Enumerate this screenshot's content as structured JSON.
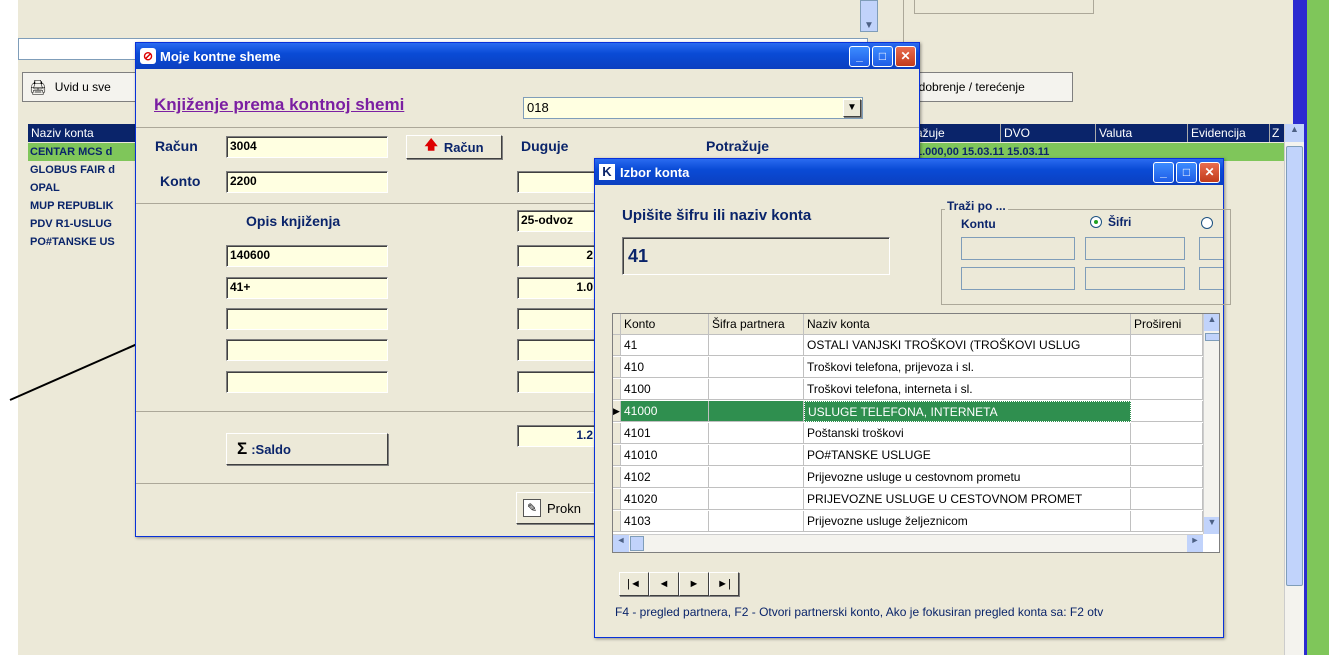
{
  "background_app": {
    "toolbar_view_label": "Uvid u sve",
    "toolbar_right_label": "odobrenje / terećenje",
    "grid_headers": [
      "Naziv konta",
      "ažuje",
      "DVO",
      "Valuta",
      "Evidencija",
      "Z"
    ],
    "grid_rows": [
      "CENTAR MCS d",
      "GLOBUS FAIR d",
      "OPAL",
      "MUP REPUBLIK",
      "PDV R1-USLUG",
      "PO#TANSKE US"
    ],
    "first_row_values": "1.000,00 15.03.11     15.03.11"
  },
  "main_window": {
    "title": "Moje kontne sheme",
    "heading": "Knjiženje prema kontnoj shemi",
    "scheme_value": "018",
    "racun_label": "Račun",
    "racun_value": "3004",
    "racun_button": "Račun",
    "duguje_label": "Duguje",
    "potrazuje_label": "Potražuje",
    "konto_label": "Konto",
    "konto_value": "2200",
    "opis_label": "Opis knjiženja",
    "opis_rows": [
      "140600",
      "41+",
      "",
      "",
      ""
    ],
    "type_value": "25-odvoz",
    "amount_rows": [
      "2",
      "1.0",
      "",
      "",
      ""
    ],
    "saldo_button": ":Saldo",
    "saldo_value": "1.2",
    "proknjizi_label": "Prokn"
  },
  "izbor_window": {
    "title": "Izbor konta",
    "prompt": "Upišite šifru ili naziv konta",
    "search_value": "41",
    "trazi_po_label": "Traži po ...",
    "kontu_label": "Kontu",
    "sifri_label": "Šifri",
    "columns": [
      "Konto",
      "Šifra partnera",
      "Naziv konta",
      "Prošireni"
    ],
    "rows": [
      {
        "konto": "41",
        "sifra": "",
        "naziv": "OSTALI VANJSKI TROŠKOVI (TROŠKOVI USLUG"
      },
      {
        "konto": "410",
        "sifra": "",
        "naziv": "Troškovi telefona, prijevoza i sl."
      },
      {
        "konto": "4100",
        "sifra": "",
        "naziv": "Troškovi telefona, interneta i sl."
      },
      {
        "konto": "41000",
        "sifra": "",
        "naziv": "USLUGE TELEFONA, INTERNETA"
      },
      {
        "konto": "4101",
        "sifra": "",
        "naziv": "Poštanski troškovi"
      },
      {
        "konto": "41010",
        "sifra": "",
        "naziv": "PO#TANSKE USLUGE"
      },
      {
        "konto": "4102",
        "sifra": "",
        "naziv": "Prijevozne usluge u cestovnom prometu"
      },
      {
        "konto": "41020",
        "sifra": "",
        "naziv": "PRIJEVOZNE USLUGE U CESTOVNOM PROMET"
      },
      {
        "konto": "4103",
        "sifra": "",
        "naziv": "Prijevozne usluge željeznicom"
      }
    ],
    "selected_row": 3,
    "footer_hint": "F4 - pregled partnera,   F2 - Otvori partnerski konto,   Ako je fokusiran pregled konta sa: F2 otv"
  },
  "colors": {
    "selection_green": "#2f8f4f",
    "title_blue": "#0a4bd6",
    "heading_purple": "#7b1fa2",
    "label_blue": "#0a246a",
    "field_yellow": "#ffffe1"
  }
}
